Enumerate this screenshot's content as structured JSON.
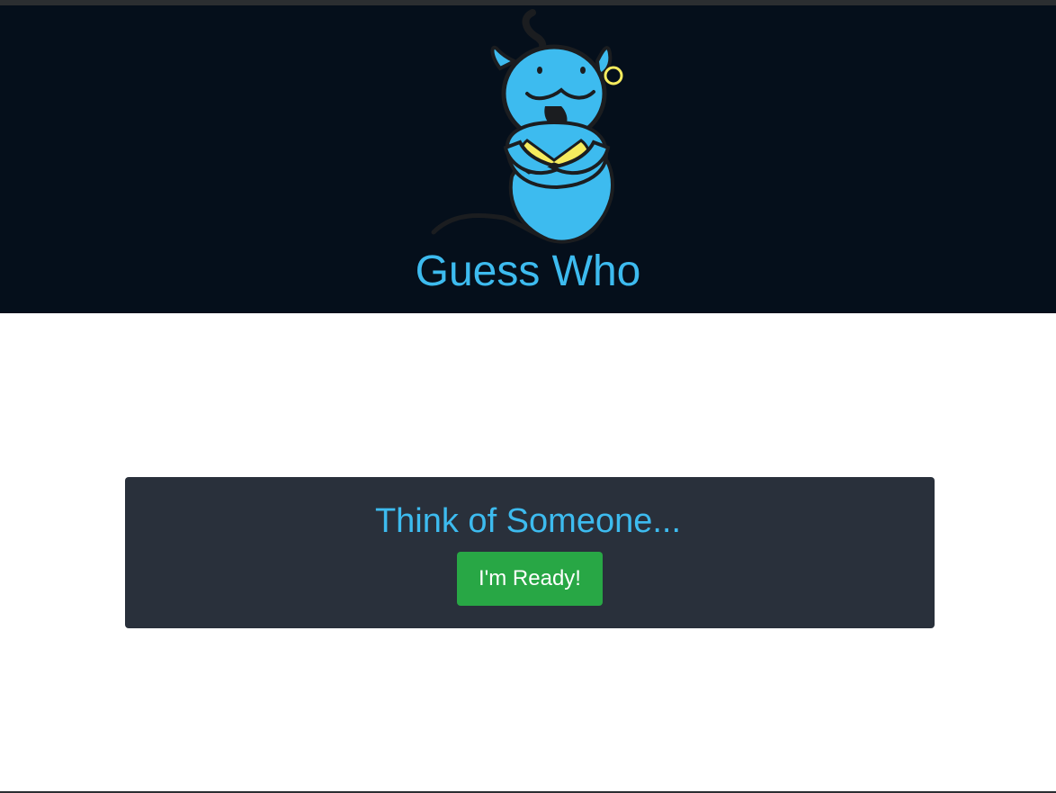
{
  "header": {
    "title": "Guess Who",
    "logo": "genie-logo"
  },
  "main": {
    "prompt": "Think of Someone...",
    "ready_button_label": "I'm Ready!"
  },
  "colors": {
    "header_bg": "#050f1b",
    "accent": "#3dbbef",
    "panel_bg": "#29303b",
    "button_green": "#28a745",
    "genie_yellow": "#f6ec5e"
  }
}
